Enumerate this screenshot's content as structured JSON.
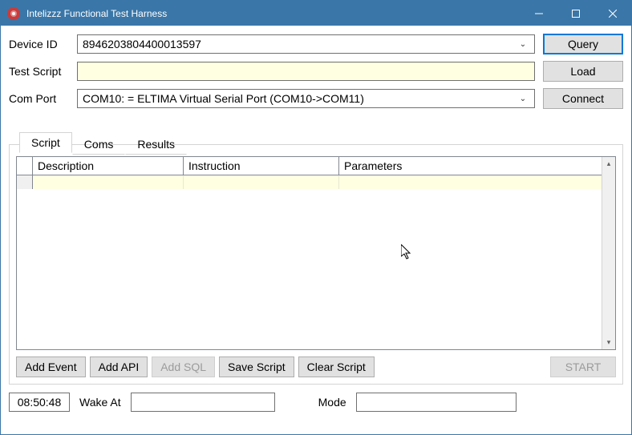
{
  "window": {
    "title": "Intelizzz Functional Test Harness"
  },
  "form": {
    "device_id_label": "Device ID",
    "device_id_value": "8946203804400013597",
    "test_script_label": "Test Script",
    "test_script_value": "",
    "com_port_label": "Com Port",
    "com_port_value": "COM10: = ELTIMA Virtual Serial Port (COM10->COM11)",
    "query_btn": "Query",
    "load_btn": "Load",
    "connect_btn": "Connect"
  },
  "tabs": {
    "script": "Script",
    "coms": "Coms",
    "results": "Results"
  },
  "grid": {
    "col_description": "Description",
    "col_instruction": "Instruction",
    "col_parameters": "Parameters"
  },
  "buttons": {
    "add_event": "Add Event",
    "add_api": "Add API",
    "add_sql": "Add SQL",
    "save_script": "Save Script",
    "clear_script": "Clear Script",
    "start": "START"
  },
  "footer": {
    "time": "08:50:48",
    "wake_at_label": "Wake At",
    "wake_at_value": "",
    "mode_label": "Mode",
    "mode_value": ""
  }
}
